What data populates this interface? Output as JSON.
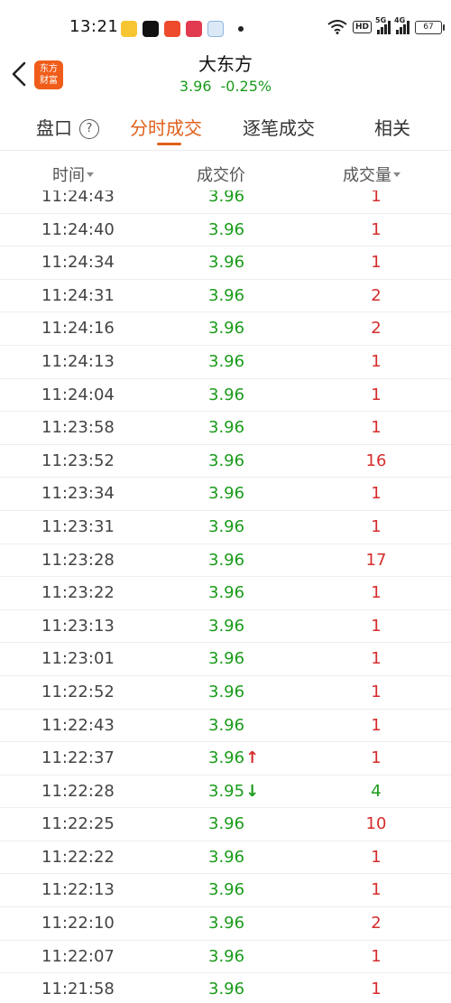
{
  "status_bar": {
    "time": "13:21",
    "hd": "HD",
    "net1": "5G",
    "net2": "4G",
    "battery": "67"
  },
  "header": {
    "logo_line1": "东方",
    "logo_line2": "财富",
    "stock_name": "大东方",
    "price": "3.96",
    "change_pct": "-0.25%"
  },
  "tabs": [
    {
      "label": "盘口"
    },
    {
      "label": "分时成交"
    },
    {
      "label": "逐笔成交"
    },
    {
      "label": "相关"
    }
  ],
  "columns": {
    "time": "时间",
    "price": "成交价",
    "volume": "成交量"
  },
  "colors": {
    "accent": "#e0601c",
    "up": "#d62c2c",
    "down": "#1a9b1a"
  },
  "rows": [
    {
      "time": "11:24:43",
      "price": "3.96",
      "arrow": "",
      "volume": "1",
      "dir": "up"
    },
    {
      "time": "11:24:40",
      "price": "3.96",
      "arrow": "",
      "volume": "1",
      "dir": "up"
    },
    {
      "time": "11:24:34",
      "price": "3.96",
      "arrow": "",
      "volume": "1",
      "dir": "up"
    },
    {
      "time": "11:24:31",
      "price": "3.96",
      "arrow": "",
      "volume": "2",
      "dir": "up"
    },
    {
      "time": "11:24:16",
      "price": "3.96",
      "arrow": "",
      "volume": "2",
      "dir": "up"
    },
    {
      "time": "11:24:13",
      "price": "3.96",
      "arrow": "",
      "volume": "1",
      "dir": "up"
    },
    {
      "time": "11:24:04",
      "price": "3.96",
      "arrow": "",
      "volume": "1",
      "dir": "up"
    },
    {
      "time": "11:23:58",
      "price": "3.96",
      "arrow": "",
      "volume": "1",
      "dir": "up"
    },
    {
      "time": "11:23:52",
      "price": "3.96",
      "arrow": "",
      "volume": "16",
      "dir": "up"
    },
    {
      "time": "11:23:34",
      "price": "3.96",
      "arrow": "",
      "volume": "1",
      "dir": "up"
    },
    {
      "time": "11:23:31",
      "price": "3.96",
      "arrow": "",
      "volume": "1",
      "dir": "up"
    },
    {
      "time": "11:23:28",
      "price": "3.96",
      "arrow": "",
      "volume": "17",
      "dir": "up"
    },
    {
      "time": "11:23:22",
      "price": "3.96",
      "arrow": "",
      "volume": "1",
      "dir": "up"
    },
    {
      "time": "11:23:13",
      "price": "3.96",
      "arrow": "",
      "volume": "1",
      "dir": "up"
    },
    {
      "time": "11:23:01",
      "price": "3.96",
      "arrow": "",
      "volume": "1",
      "dir": "up"
    },
    {
      "time": "11:22:52",
      "price": "3.96",
      "arrow": "",
      "volume": "1",
      "dir": "up"
    },
    {
      "time": "11:22:43",
      "price": "3.96",
      "arrow": "",
      "volume": "1",
      "dir": "up"
    },
    {
      "time": "11:22:37",
      "price": "3.96",
      "arrow": "↑",
      "volume": "1",
      "dir": "up"
    },
    {
      "time": "11:22:28",
      "price": "3.95",
      "arrow": "↓",
      "volume": "4",
      "dir": "down"
    },
    {
      "time": "11:22:25",
      "price": "3.96",
      "arrow": "",
      "volume": "10",
      "dir": "up"
    },
    {
      "time": "11:22:22",
      "price": "3.96",
      "arrow": "",
      "volume": "1",
      "dir": "up"
    },
    {
      "time": "11:22:13",
      "price": "3.96",
      "arrow": "",
      "volume": "1",
      "dir": "up"
    },
    {
      "time": "11:22:10",
      "price": "3.96",
      "arrow": "",
      "volume": "2",
      "dir": "up"
    },
    {
      "time": "11:22:07",
      "price": "3.96",
      "arrow": "",
      "volume": "1",
      "dir": "up"
    },
    {
      "time": "11:21:58",
      "price": "3.96",
      "arrow": "",
      "volume": "1",
      "dir": "up"
    }
  ]
}
